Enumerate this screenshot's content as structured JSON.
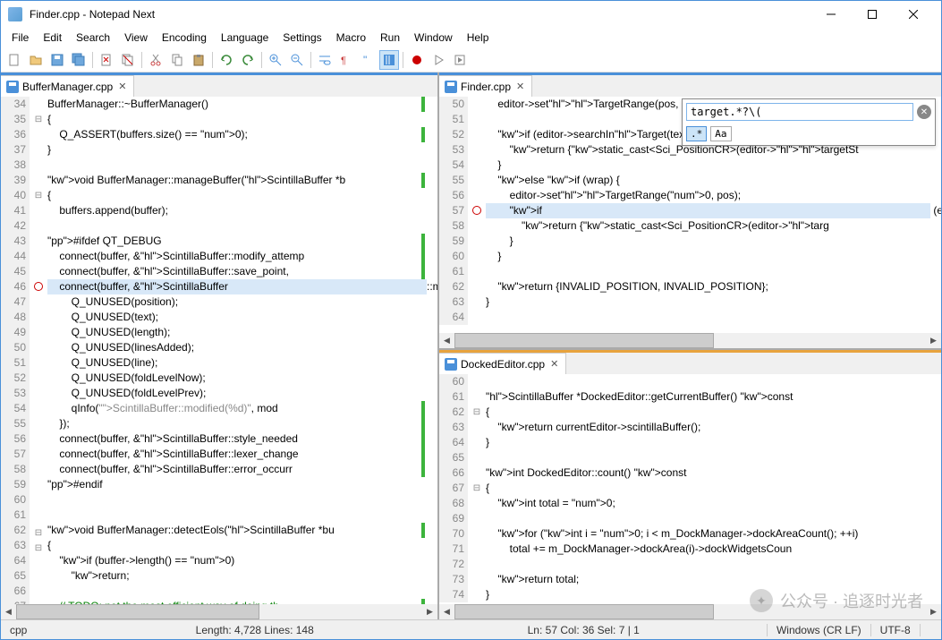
{
  "window": {
    "title": "Finder.cpp - Notepad Next"
  },
  "menu": [
    "File",
    "Edit",
    "Search",
    "View",
    "Encoding",
    "Language",
    "Settings",
    "Macro",
    "Run",
    "Window",
    "Help"
  ],
  "tabs": {
    "left": {
      "label": "BufferManager.cpp"
    },
    "topright": {
      "label": "Finder.cpp"
    },
    "bottomright": {
      "label": "DockedEditor.cpp"
    }
  },
  "find": {
    "value": "target.*?\\(",
    "regex_label": ".*",
    "case_label": "Aa"
  },
  "status": {
    "lang": "cpp",
    "length": "Length: 4,728    Lines: 148",
    "pos": "Ln: 57    Col: 36    Sel: 7 | 1",
    "spacer": " ",
    "eol": "Windows (CR LF)",
    "enc": "UTF-8"
  },
  "watermark": "公众号 · 追逐时光者",
  "left_editor": {
    "start": 34,
    "lines": [
      "BufferManager::~BufferManager()",
      "{",
      "    Q_ASSERT(buffers.size() == 0);",
      "}",
      "",
      "void BufferManager::manageBuffer(ScintillaBuffer *b",
      "{",
      "    buffers.append(buffer);",
      "",
      "#ifdef QT_DEBUG",
      "    connect(buffer, &ScintillaBuffer::modify_attemp",
      "    connect(buffer, &ScintillaBuffer::save_point,",
      "    connect(buffer, &ScintillaBuffer::modified, []",
      "        Q_UNUSED(position);",
      "        Q_UNUSED(text);",
      "        Q_UNUSED(length);",
      "        Q_UNUSED(linesAdded);",
      "        Q_UNUSED(line);",
      "        Q_UNUSED(foldLevelNow);",
      "        Q_UNUSED(foldLevelPrev);",
      "        qInfo(\"ScintillaBuffer::modified(%d)\", mod",
      "    });",
      "    connect(buffer, &ScintillaBuffer::style_needed",
      "    connect(buffer, &ScintillaBuffer::lexer_change",
      "    connect(buffer, &ScintillaBuffer::error_occurr",
      "#endif",
      "",
      "",
      "void BufferManager::detectEols(ScintillaBuffer *bu",
      "{",
      "    if (buffer->length() == 0)",
      "        return;",
      "",
      "    // TODO: not the most efficient way of doing th"
    ]
  },
  "top_editor": {
    "start": 50,
    "lines": [
      "    editor->setTargetRange(pos, editor->length())",
      "",
      "    if (editor->searchInTarget(textData.length(),",
      "        return {static_cast<Sci_PositionCR>(editor->targetSt",
      "    }",
      "    else if (wrap) {",
      "        editor->setTargetRange(0, pos);",
      "        if (editor->searchInTarget(textData.length(), textDa",
      "            return {static_cast<Sci_PositionCR>(editor->targ",
      "        }",
      "    }",
      "",
      "    return {INVALID_POSITION, INVALID_POSITION};",
      "}",
      ""
    ]
  },
  "bottom_editor": {
    "start": 60,
    "lines": [
      "",
      "ScintillaBuffer *DockedEditor::getCurrentBuffer() const",
      "{",
      "    return currentEditor->scintillaBuffer();",
      "}",
      "",
      "int DockedEditor::count() const",
      "{",
      "    int total = 0;",
      "",
      "    for (int i = 0; i < m_DockManager->dockAreaCount(); ++i)",
      "        total += m_DockManager->dockArea(i)->dockWidgetsCoun",
      "",
      "    return total;",
      "}"
    ]
  }
}
